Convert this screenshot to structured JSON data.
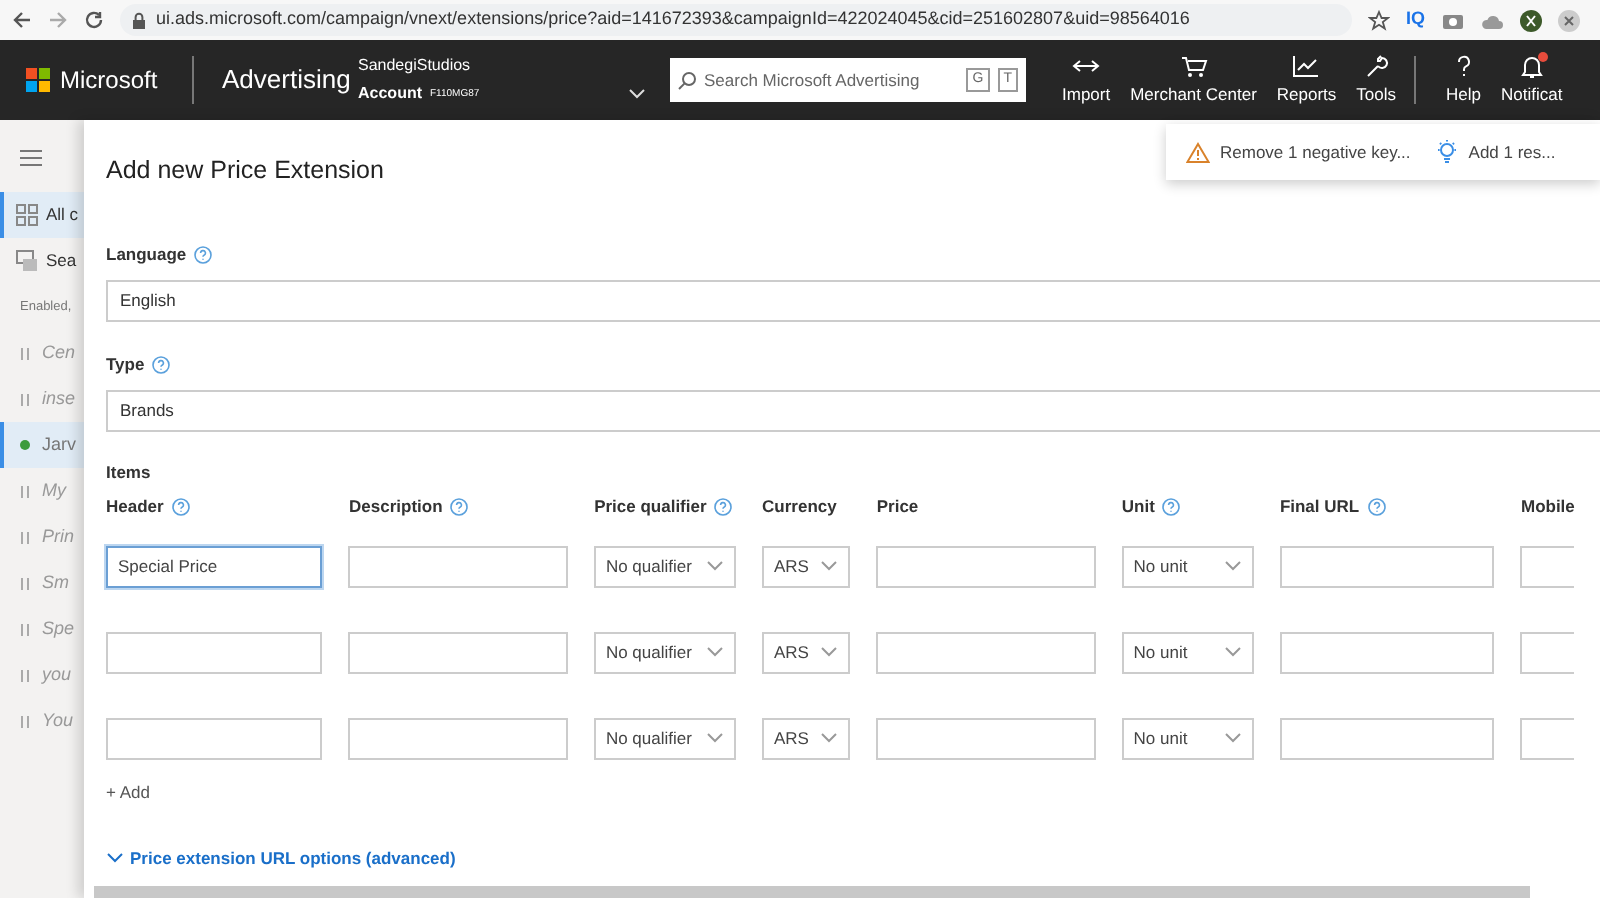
{
  "browser": {
    "url": "ui.ads.microsoft.com/campaign/vnext/extensions/price?aid=141672393&campaignId=422024045&cid=251602807&uid=98564016",
    "extension_label": "IQ"
  },
  "header": {
    "brand": "Microsoft",
    "product": "Advertising",
    "account_name": "SandegiStudios",
    "account_label": "Account",
    "account_id": "F110MG87",
    "search": {
      "placeholder": "Search Microsoft Advertising",
      "keys": [
        "G",
        "T"
      ]
    },
    "tools": [
      {
        "label": "Import"
      },
      {
        "label": "Merchant Center"
      },
      {
        "label": "Reports"
      },
      {
        "label": "Tools"
      },
      {
        "label": "Help"
      },
      {
        "label": "Notificat",
        "badge": true
      }
    ]
  },
  "sidebar": {
    "items": [
      {
        "kind": "nav",
        "label": "All c",
        "selected": true
      },
      {
        "kind": "nav",
        "label": "Sea",
        "selected": false
      },
      {
        "kind": "heading",
        "label": "Enabled,"
      },
      {
        "kind": "campaign",
        "label": "Cen",
        "paused": true,
        "selected": false
      },
      {
        "kind": "campaign",
        "label": "inse",
        "paused": true,
        "selected": false
      },
      {
        "kind": "campaign",
        "label": "Jarv",
        "paused": false,
        "selected": true
      },
      {
        "kind": "campaign",
        "label": "My",
        "paused": true,
        "selected": false
      },
      {
        "kind": "campaign",
        "label": "Prin",
        "paused": true,
        "selected": false
      },
      {
        "kind": "campaign",
        "label": "Sm",
        "paused": true,
        "selected": false
      },
      {
        "kind": "campaign",
        "label": "Spe",
        "paused": true,
        "selected": false
      },
      {
        "kind": "campaign",
        "label": "you",
        "paused": true,
        "selected": false
      },
      {
        "kind": "campaign",
        "label": "You",
        "paused": true,
        "selected": false
      }
    ]
  },
  "notifications": [
    {
      "kind": "warning",
      "text": "Remove 1 negative key..."
    },
    {
      "kind": "tip",
      "text": "Add 1 res..."
    }
  ],
  "panel": {
    "title": "Add new Price Extension",
    "language": {
      "label": "Language",
      "help": true,
      "value": "English"
    },
    "type": {
      "label": "Type",
      "help": true,
      "value": "Brands"
    },
    "items": {
      "label": "Items",
      "columns": [
        {
          "label": "Header",
          "help": true,
          "kind": "text"
        },
        {
          "label": "Description",
          "help": true,
          "kind": "text"
        },
        {
          "label": "Price qualifier",
          "help": true,
          "kind": "select"
        },
        {
          "label": "Currency",
          "help": false,
          "kind": "select"
        },
        {
          "label": "Price",
          "help": false,
          "kind": "text"
        },
        {
          "label": "Unit",
          "help": true,
          "kind": "select"
        },
        {
          "label": "Final URL",
          "help": true,
          "kind": "text"
        },
        {
          "label": "Mobile",
          "help": false,
          "kind": "text"
        }
      ],
      "rows": [
        {
          "cells": [
            "Special Price",
            null,
            "No qualifier",
            "ARS",
            null,
            "No unit",
            null,
            null
          ],
          "focused": true
        },
        {
          "cells": [
            null,
            null,
            "No qualifier",
            "ARS",
            null,
            "No unit",
            null,
            null
          ],
          "focused": false
        },
        {
          "cells": [
            null,
            null,
            "No qualifier",
            "ARS",
            null,
            "No unit",
            null,
            null
          ],
          "focused": false
        }
      ],
      "add_label": "+ Add"
    },
    "advanced_link": "Price extension URL options (advanced)"
  }
}
